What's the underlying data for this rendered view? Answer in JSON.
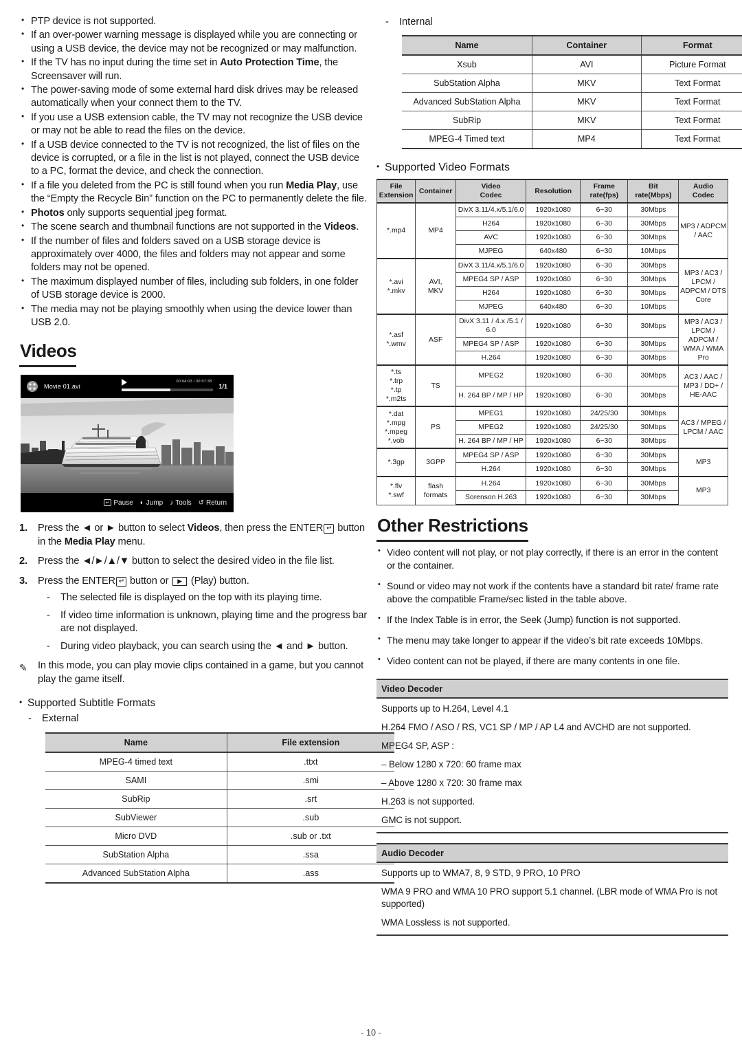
{
  "page": {
    "number": "- 10 -"
  },
  "left": {
    "usb_notes": [
      "PTP device is not supported.",
      "If an over-power warning message is displayed while you are connecting or using a USB device, the device may not be recognized or may malfunction.",
      "If the TV has no input during the time set in |Auto Protection Time|, the Screensaver will run.",
      "The power-saving mode of some external hard disk drives may be released automatically when your connect them to the TV.",
      "If you use a USB extension cable, the TV may not recognize the USB device or may not be able to read the files on the device.",
      "If a USB device connected to the TV is not recognized, the list of files on the device is corrupted, or a file in the list is not played, connect the USB device to a PC, format the device, and check the connection.",
      "If a file you deleted from the PC is still found when you run |Media Play|, use the “Empty the Recycle Bin” function on the PC to permanently delete the file.",
      "|Photos| only supports sequential jpeg format.",
      "The scene search and thumbnail functions are not supported in the |Videos|.",
      "If the number of files and folders saved on a USB storage device is approximately over 4000, the files and folders may not appear and some folders may not be opened.",
      "The maximum displayed number of files, including sub folders, in one folder of USB storage device is 2000.",
      "The media may not be playing smoothly when using the device lower than USB 2.0."
    ],
    "videos_heading": "Videos",
    "tv": {
      "filename": "Movie 01.avi",
      "time": "00:04:03 / 00:07:38",
      "page_indicator": "1/1",
      "keys": [
        {
          "icon": "enter-key-icon",
          "label": "Pause"
        },
        {
          "icon": "left-right-key-icon",
          "label": "Jump"
        },
        {
          "icon": "tools-key-icon",
          "label": "Tools"
        },
        {
          "icon": "return-key-icon",
          "label": "Return"
        }
      ]
    },
    "steps": [
      {
        "num": "1.",
        "text": "Press the ◄ or ► button to select |Videos|, then press the ENTER[E] button in the |Media Play| menu."
      },
      {
        "num": "2.",
        "text": "Press the ◄/►/▲/▼ button to select the desired video in the file list."
      },
      {
        "num": "3.",
        "text": "Press the ENTER[E] button or [P] (Play) button."
      }
    ],
    "step3_dashes": [
      "The selected file is displayed on the top with its playing time.",
      "If video time information is unknown, playing time and the progress bar are not displayed.",
      "During video playback, you can search using the ◄ and ► button."
    ],
    "note": "In this mode, you can play movie clips contained in a game, but you cannot play the game itself.",
    "subtitle_heading": "Supported Subtitle Formats",
    "external_label": "External",
    "external_table": {
      "headers": [
        "Name",
        "File extension"
      ],
      "rows": [
        [
          "MPEG-4 timed text",
          ".ttxt"
        ],
        [
          "SAMI",
          ".smi"
        ],
        [
          "SubRip",
          ".srt"
        ],
        [
          "SubViewer",
          ".sub"
        ],
        [
          "Micro DVD",
          ".sub or .txt"
        ],
        [
          "SubStation Alpha",
          ".ssa"
        ],
        [
          "Advanced SubStation Alpha",
          ".ass"
        ]
      ]
    }
  },
  "right": {
    "internal_label": "Internal",
    "internal_table": {
      "headers": [
        "Name",
        "Container",
        "Format"
      ],
      "rows": [
        [
          "Xsub",
          "AVI",
          "Picture Format"
        ],
        [
          "SubStation Alpha",
          "MKV",
          "Text Format"
        ],
        [
          "Advanced SubStation Alpha",
          "MKV",
          "Text Format"
        ],
        [
          "SubRip",
          "MKV",
          "Text Format"
        ],
        [
          "MPEG-4 Timed text",
          "MP4",
          "Text Format"
        ]
      ]
    },
    "video_formats_heading": "Supported Video Formats",
    "video_formats_table": {
      "headers": [
        "File Extension",
        "Container",
        "Video Codec",
        "Resolution",
        "Frame rate(fps)",
        "Bit rate(Mbps)",
        "Audio Codec"
      ],
      "groups": [
        {
          "extension": "*.mp4",
          "container": "MP4",
          "audio": "MP3 / ADPCM / AAC",
          "codecs": [
            {
              "codec": "DivX 3.11/4.x/5.1/6.0",
              "resolution": "1920x1080",
              "fps": "6~30",
              "bitrate": "30Mbps"
            },
            {
              "codec": "H264",
              "resolution": "1920x1080",
              "fps": "6~30",
              "bitrate": "30Mbps"
            },
            {
              "codec": "AVC",
              "resolution": "1920x1080",
              "fps": "6~30",
              "bitrate": "30Mbps"
            },
            {
              "codec": "MJPEG",
              "resolution": "640x480",
              "fps": "6~30",
              "bitrate": "10Mbps"
            }
          ]
        },
        {
          "extension": "*.avi\n*.mkv",
          "container": "AVI,\nMKV",
          "audio": "MP3 / AC3 / LPCM / ADPCM / DTS Core",
          "codecs": [
            {
              "codec": "DivX 3.11/4.x/5.1/6.0",
              "resolution": "1920x1080",
              "fps": "6~30",
              "bitrate": "30Mbps"
            },
            {
              "codec": "MPEG4 SP / ASP",
              "resolution": "1920x1080",
              "fps": "6~30",
              "bitrate": "30Mbps"
            },
            {
              "codec": "H264",
              "resolution": "1920x1080",
              "fps": "6~30",
              "bitrate": "30Mbps"
            },
            {
              "codec": "MJPEG",
              "resolution": "640x480",
              "fps": "6~30",
              "bitrate": "10Mbps"
            }
          ]
        },
        {
          "extension": "*.asf\n*.wmv",
          "container": "ASF",
          "audio": "MP3 / AC3 / LPCM / ADPCM / WMA / WMA Pro",
          "codecs": [
            {
              "codec": "DivX 3.11 / 4.x /5.1 / 6.0",
              "resolution": "1920x1080",
              "fps": "6~30",
              "bitrate": "30Mbps"
            },
            {
              "codec": "MPEG4 SP / ASP",
              "resolution": "1920x1080",
              "fps": "6~30",
              "bitrate": "30Mbps"
            },
            {
              "codec": "H.264",
              "resolution": "1920x1080",
              "fps": "6~30",
              "bitrate": "30Mbps"
            }
          ]
        },
        {
          "extension": "*.ts\n*.trp\n*.tp\n*.m2ts",
          "container": "TS",
          "audio": "AC3 / AAC / MP3 / DD+ / HE-AAC",
          "codecs": [
            {
              "codec": "MPEG2",
              "resolution": "1920x1080",
              "fps": "6~30",
              "bitrate": "30Mbps"
            },
            {
              "codec": "H. 264 BP / MP / HP",
              "resolution": "1920x1080",
              "fps": "6~30",
              "bitrate": "30Mbps"
            }
          ]
        },
        {
          "extension": "*.dat\n*.mpg\n*.mpeg\n*.vob",
          "container": "PS",
          "audio": "AC3 / MPEG / LPCM / AAC",
          "codecs": [
            {
              "codec": "MPEG1",
              "resolution": "1920x1080",
              "fps": "24/25/30",
              "bitrate": "30Mbps"
            },
            {
              "codec": "MPEG2",
              "resolution": "1920x1080",
              "fps": "24/25/30",
              "bitrate": "30Mbps"
            },
            {
              "codec": "H. 264 BP / MP / HP",
              "resolution": "1920x1080",
              "fps": "6~30",
              "bitrate": "30Mbps"
            }
          ]
        },
        {
          "extension": "*.3gp",
          "container": "3GPP",
          "audio": "MP3",
          "codecs": [
            {
              "codec": "MPEG4 SP / ASP",
              "resolution": "1920x1080",
              "fps": "6~30",
              "bitrate": "30Mbps"
            },
            {
              "codec": "H.264",
              "resolution": "1920x1080",
              "fps": "6~30",
              "bitrate": "30Mbps"
            }
          ]
        },
        {
          "extension": "*.flv\n*.swf",
          "container": "flash\nformats",
          "audio": "MP3",
          "codecs": [
            {
              "codec": "H.264",
              "resolution": "1920x1080",
              "fps": "6~30",
              "bitrate": "30Mbps"
            },
            {
              "codec": "Sorenson H.263",
              "resolution": "1920x1080",
              "fps": "6~30",
              "bitrate": "30Mbps"
            }
          ]
        }
      ]
    },
    "other_restrictions_heading": "Other Restrictions",
    "other_restrictions": [
      "Video content will not play, or not play correctly, if there is an error in the content or the container.",
      "Sound or video may not work if the contents have a standard bit rate/ frame rate above the compatible Frame/sec listed in the table above.",
      "If the Index Table is in error, the Seek (Jump) function is not supported.",
      "The menu may take longer to appear if the video’s bit rate exceeds 10Mbps.",
      "Video content can not be played, if there are many contents in one file."
    ],
    "video_decoder": {
      "title": "Video Decoder",
      "lines": [
        "Supports up to H.264, Level 4.1",
        "H.264 FMO / ASO / RS, VC1 SP / MP / AP L4 and AVCHD are not supported.",
        "MPEG4 SP, ASP :",
        "– Below 1280 x 720: 60 frame max",
        "– Above 1280 x 720: 30 frame max",
        "H.263 is not supported.",
        "GMC is not support."
      ]
    },
    "audio_decoder": {
      "title": "Audio Decoder",
      "lines": [
        "Supports up to WMA7, 8, 9 STD, 9 PRO, 10 PRO",
        "WMA 9 PRO and WMA 10 PRO support  5.1 channel. (LBR mode of WMA Pro is not supported)",
        "WMA Lossless is not supported."
      ]
    }
  }
}
